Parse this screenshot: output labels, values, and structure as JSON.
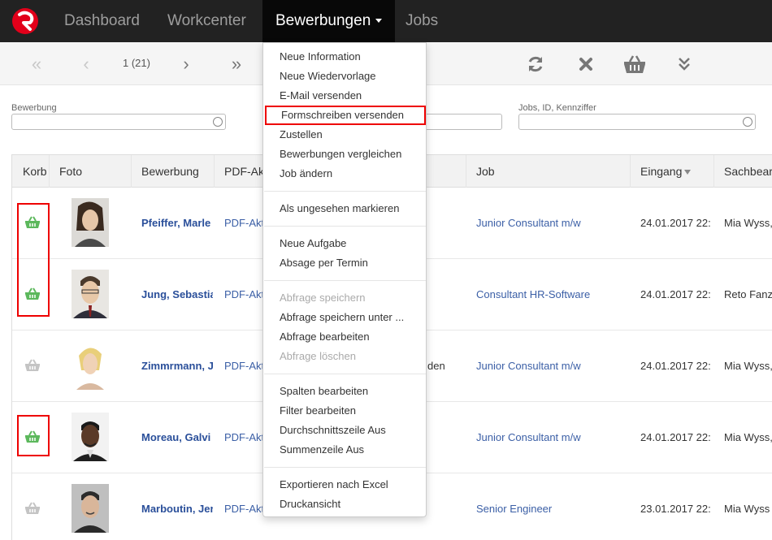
{
  "nav": {
    "items": [
      "Dashboard",
      "Workcenter",
      "Bewerbungen",
      "Jobs"
    ]
  },
  "toolbar": {
    "page_indicator": "1 (21)"
  },
  "filters": {
    "bewerbung_label": "Bewerbung",
    "jobs_label": "Jobs, ID, Kennziffer"
  },
  "table": {
    "headers": [
      "Korb",
      "Foto",
      "Bewerbung",
      "PDF-Akte",
      "",
      "Job",
      "Eingang",
      "Sachbearbeiter"
    ],
    "rows": [
      {
        "name": "Pfeiffer, Marle",
        "pdf": "PDF-Akt",
        "extra": "",
        "job": "Junior Consultant m/w",
        "date": "24.01.2017 22:",
        "person": "Mia Wyss,"
      },
      {
        "name": "Jung, Sebastia",
        "pdf": "PDF-Akt",
        "extra": "",
        "job": "Consultant HR-Software",
        "date": "24.01.2017 22:",
        "person": "Reto Fanz"
      },
      {
        "name": "Zimmrmann, J",
        "pdf": "PDF-Akt",
        "extra": "den",
        "job": "Junior Consultant m/w",
        "date": "24.01.2017 22:",
        "person": "Mia Wyss,"
      },
      {
        "name": "Moreau, Galvi",
        "pdf": "PDF-Akt",
        "extra": "",
        "job": "Junior Consultant m/w",
        "date": "24.01.2017 22:",
        "person": "Mia Wyss,"
      },
      {
        "name": "Marboutin, Jer",
        "pdf": "PDF-Akt",
        "extra": "",
        "job": "Senior Engineer",
        "date": "23.01.2017 22:",
        "person": "Mia Wyss"
      }
    ]
  },
  "dropdown": {
    "items": [
      "Neue Information",
      "Neue Wiedervorlage",
      "E-Mail versenden",
      "Formschreiben versenden",
      "Zustellen",
      "Bewerbungen vergleichen",
      "Job ändern",
      "Als ungesehen markieren",
      "Neue Aufgabe",
      "Absage per Termin",
      "Abfrage speichern",
      "Abfrage speichern unter ...",
      "Abfrage bearbeiten",
      "Abfrage löschen",
      "Spalten bearbeiten",
      "Filter bearbeiten",
      "Durchschnittszeile Aus",
      "Summenzeile Aus",
      "Exportieren nach Excel",
      "Druckansicht"
    ]
  },
  "colors": {
    "navbar": "#222222",
    "active_nav": "#080808",
    "brand_red": "#e2001a",
    "link_blue": "#3b5fa6",
    "basket_green": "#5cb85c",
    "highlight_red": "#ee0000"
  },
  "icons": [
    "first-page-icon",
    "prev-page-icon",
    "next-page-icon",
    "last-page-icon",
    "refresh-icon",
    "close-icon",
    "basket-icon",
    "expand-icon",
    "search-icon"
  ]
}
